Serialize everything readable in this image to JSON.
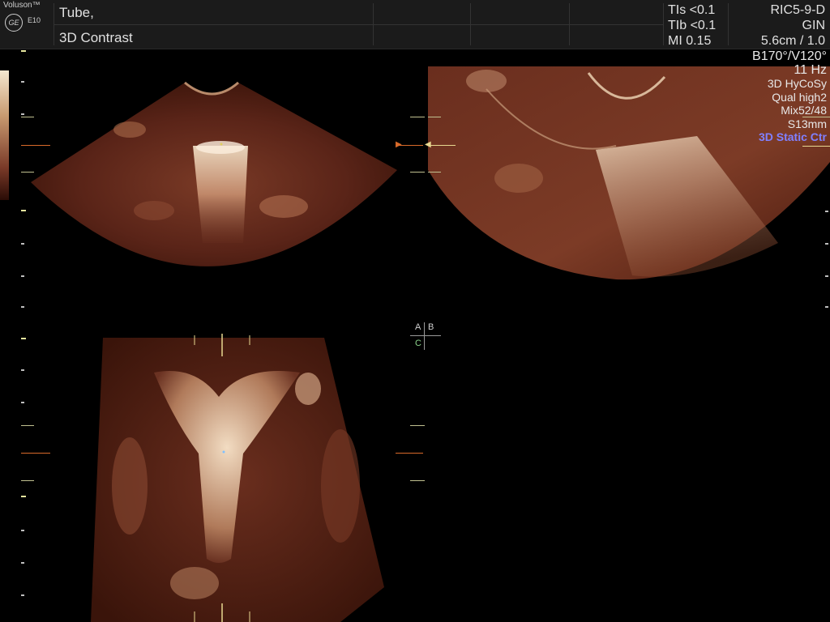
{
  "header": {
    "brand": "Voluson™",
    "logo_text": "GE",
    "model": "E10",
    "title_line1": "Tube,",
    "title_line2": "3D Contrast",
    "safety": [
      "TIs <0.1",
      "TIb <0.1",
      "MI 0.15"
    ],
    "probe": [
      "RIC5-9-D",
      "GIN",
      "5.6cm / 1.0"
    ]
  },
  "params": {
    "angles": "B170°/V120°",
    "frame_rate": "11 Hz",
    "mode_3d": "3D HyCoSy",
    "quality": "Qual high2",
    "mix": "Mix52/48",
    "slice": "S13mm",
    "render_mode": "3D Static Ctr"
  },
  "planes": {
    "a": "A",
    "b": "B",
    "c": "C"
  },
  "colors": {
    "tint_light": "#f0d2b0",
    "tint_mid": "#8a4a32",
    "tint_dark": "#2a0a05",
    "accent": "#d86a2a",
    "mode_text": "#8080ff"
  }
}
